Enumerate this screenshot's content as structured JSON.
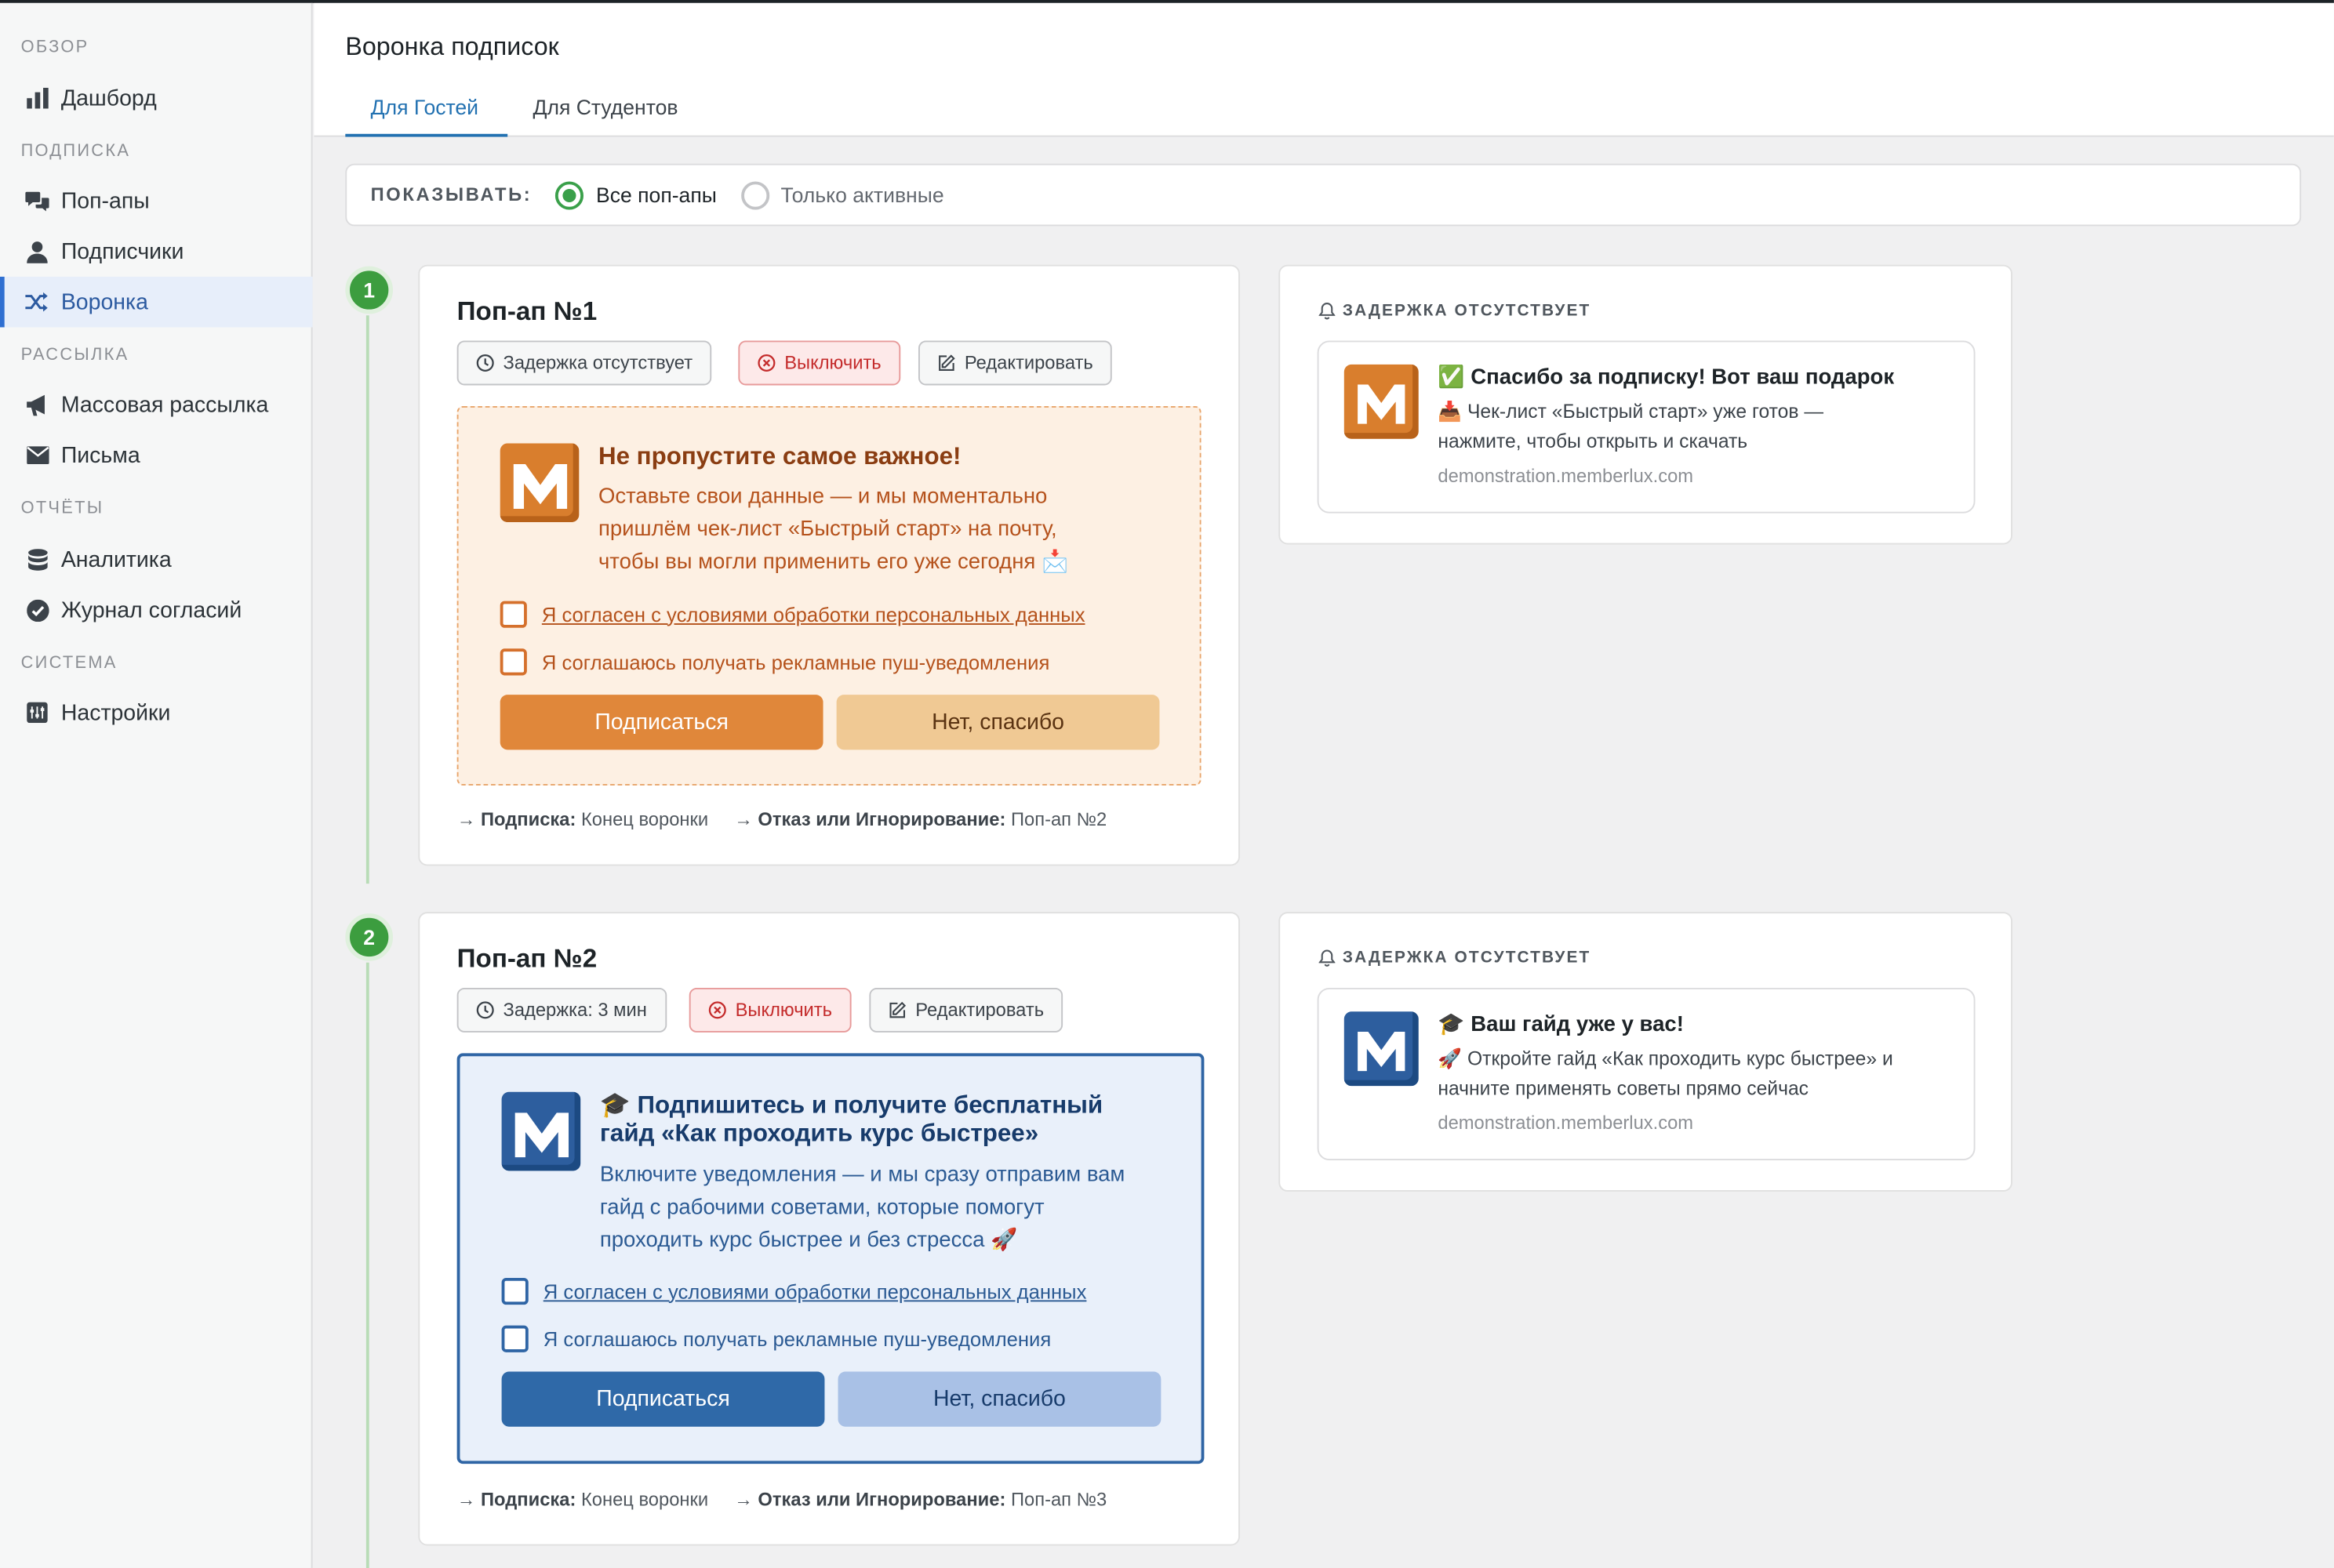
{
  "sidebar": {
    "sections": [
      {
        "title": "ОБЗОР",
        "items": [
          {
            "label": "Дашборд",
            "icon": "bar-chart-icon"
          }
        ]
      },
      {
        "title": "ПОДПИСКА",
        "items": [
          {
            "label": "Поп-апы",
            "icon": "chat-bubbles-icon"
          },
          {
            "label": "Подписчики",
            "icon": "user-icon"
          },
          {
            "label": "Воронка",
            "icon": "shuffle-icon",
            "active": true
          }
        ]
      },
      {
        "title": "РАССЫЛКА",
        "items": [
          {
            "label": "Массовая рассылка",
            "icon": "megaphone-icon"
          },
          {
            "label": "Письма",
            "icon": "envelope-icon"
          }
        ]
      },
      {
        "title": "ОТЧЁТЫ",
        "items": [
          {
            "label": "Аналитика",
            "icon": "database-icon"
          },
          {
            "label": "Журнал согласий",
            "icon": "check-circle-icon"
          }
        ]
      },
      {
        "title": "СИСТЕМА",
        "items": [
          {
            "label": "Настройки",
            "icon": "settings-icon"
          }
        ]
      }
    ]
  },
  "header": {
    "title": "Воронка подписок",
    "tabs": [
      {
        "label": "Для Гостей",
        "active": true
      },
      {
        "label": "Для Студентов",
        "active": false
      }
    ]
  },
  "filter": {
    "label": "ПОКАЗЫВАТЬ:",
    "options": [
      {
        "label": "Все поп-апы",
        "selected": true
      },
      {
        "label": "Только активные",
        "selected": false
      }
    ]
  },
  "popups": [
    {
      "step": "1",
      "title": "Поп-ап №1",
      "delay": "Задержка отсутствует",
      "disable": "Выключить",
      "edit": "Редактировать",
      "theme": "orange",
      "preview": {
        "headline": "Не пропустите самое важное!",
        "body_lines": [
          "Оставьте свои данные — и мы моментально",
          "пришлём чек-лист «Быстрый старт» на почту,",
          "чтобы вы могли применить его уже сегодня 📩"
        ],
        "consent_personal": "Я согласен с условиями обработки персональных данных",
        "consent_push": "Я соглашаюсь получать рекламные пуш-уведомления",
        "subscribe": "Подписаться",
        "decline": "Нет, спасибо"
      },
      "route_sub_label": "Подписка:",
      "route_sub_value": "Конец воронки",
      "route_refuse_label": "Отказ или Игнорирование:",
      "route_refuse_value": "Поп-ап №2",
      "notification": {
        "delay_title": "ЗАДЕРЖКА ОТСУТСТВУЕТ",
        "headline": "✅ Спасибо за подписку! Вот ваш подарок",
        "body_lines": [
          "📥 Чек-лист «Быстрый старт» уже готов —",
          "нажмите, чтобы открыть и скачать"
        ],
        "url": "demonstration.memberlux.com"
      }
    },
    {
      "step": "2",
      "title": "Поп-ап №2",
      "delay": "Задержка: 3 мин",
      "disable": "Выключить",
      "edit": "Редактировать",
      "theme": "blue",
      "preview": {
        "headline_lines": [
          "🎓 Подпишитесь и получите бесплатный",
          "гайд «Как проходить курс быстрее»"
        ],
        "body_lines": [
          "Включите уведомления — и мы сразу отправим вам",
          "гайд с рабочими советами, которые помогут",
          "проходить курс быстрее и без стресса 🚀"
        ],
        "consent_personal": "Я согласен с условиями обработки персональных данных",
        "consent_push": "Я соглашаюсь получать рекламные пуш-уведомления",
        "subscribe": "Подписаться",
        "decline": "Нет, спасибо"
      },
      "route_sub_label": "Подписка:",
      "route_sub_value": "Конец воронки",
      "route_refuse_label": "Отказ или Игнорирование:",
      "route_refuse_value": "Поп-ап №3",
      "notification": {
        "delay_title": "ЗАДЕРЖКА ОТСУТСТВУЕТ",
        "headline": "🎓 Ваш гайд уже у вас!",
        "body_lines": [
          "🚀 Откройте гайд «Как проходить курс быстрее» и",
          "начните применять советы прямо сейчас"
        ],
        "url": "demonstration.memberlux.com"
      }
    }
  ],
  "colors": {
    "accent": "#2271b1",
    "orange_primary": "#e0873a",
    "orange_secondary": "#f0c994",
    "blue_primary": "#2f69a8",
    "blue_secondary": "#a9c1e6",
    "step_green": "#3c9d3f"
  }
}
